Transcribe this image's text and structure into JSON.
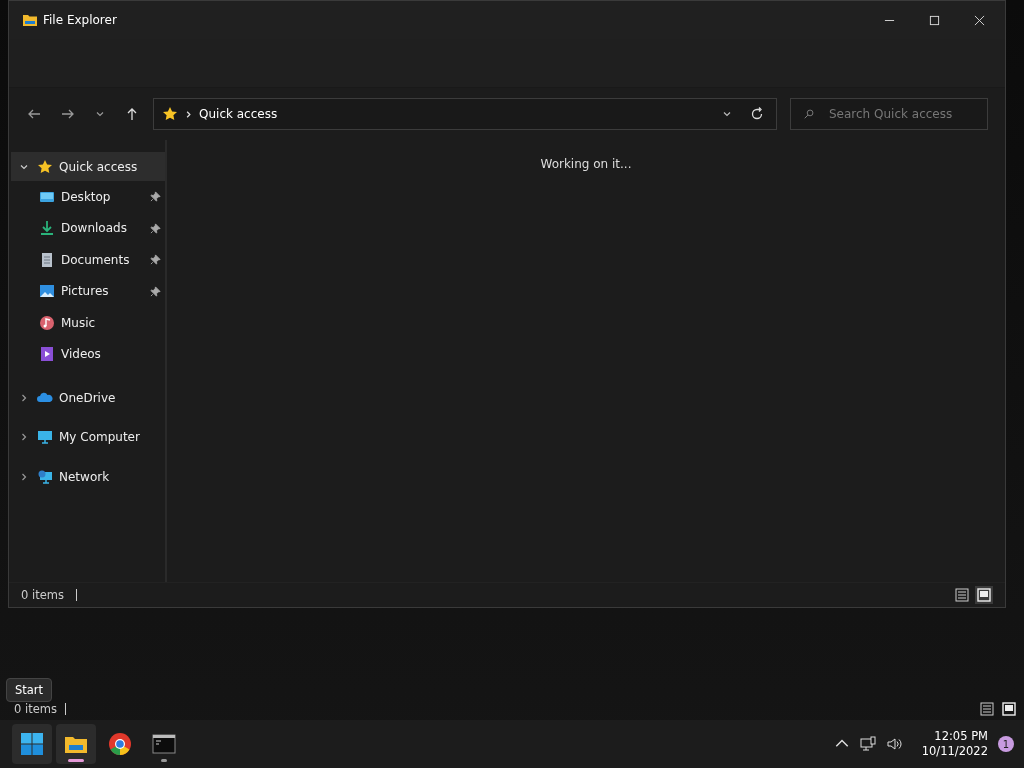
{
  "window": {
    "title": "File Explorer"
  },
  "navigation": {
    "address": "Quick access",
    "search": {
      "placeholder": "Search Quick access"
    }
  },
  "sidebar": {
    "items": [
      {
        "label": "Quick access",
        "kind": "star",
        "expanded": true,
        "selected": true,
        "children": [
          {
            "label": "Desktop",
            "kind": "desktop",
            "pinned": true,
            "selected": false
          },
          {
            "label": "Downloads",
            "kind": "download",
            "pinned": true,
            "selected": false
          },
          {
            "label": "Documents",
            "kind": "document",
            "pinned": true,
            "selected": false
          },
          {
            "label": "Pictures",
            "kind": "pictures",
            "pinned": true,
            "selected": false
          },
          {
            "label": "Music",
            "kind": "music",
            "pinned": false,
            "selected": false
          },
          {
            "label": "Videos",
            "kind": "videos",
            "pinned": false,
            "selected": false
          }
        ]
      },
      {
        "label": "OneDrive",
        "kind": "cloud",
        "expanded": false,
        "selected": false
      },
      {
        "label": "My Computer",
        "kind": "computer",
        "expanded": false,
        "selected": false
      },
      {
        "label": "Network",
        "kind": "network",
        "expanded": false,
        "selected": false
      }
    ]
  },
  "content": {
    "message": "Working on it..."
  },
  "status_bar": {
    "count": "0 items",
    "views": [
      {
        "kind": "details",
        "selected": false
      },
      {
        "kind": "tiles",
        "selected": true
      }
    ]
  },
  "desktop_remnant": {
    "count": "0 items"
  },
  "tooltip": {
    "text": "Start"
  },
  "taskbar": {
    "apps": [
      {
        "kind": "start",
        "running": false
      },
      {
        "kind": "explorer",
        "running": true
      },
      {
        "kind": "browser",
        "running": false
      },
      {
        "kind": "terminal",
        "running": true
      }
    ],
    "clock": {
      "time": "12:05 PM",
      "date": "10/11/2022"
    },
    "notifications": "1"
  }
}
